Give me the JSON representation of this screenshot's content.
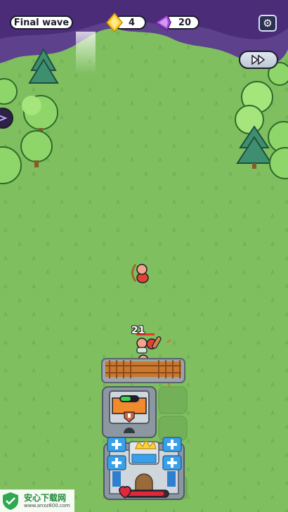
{
  "hud": {
    "wave_label": "Final wave",
    "gold_count": "4",
    "purple_count": "20"
  },
  "icons": {
    "settings": "gear-icon",
    "fast_forward": "fast-forward-icon",
    "gold_gem": "gold-diamond-icon",
    "purple_gem": "purple-crystal-icon",
    "heart": "heart-icon"
  },
  "battle": {
    "enemy_count": "21",
    "castle_health": 0.92
  },
  "colors": {
    "grass": "#7fbf5f",
    "fog": "#5c3a8e",
    "heart": "#e0283a",
    "gold": "#ffd23a",
    "purple": "#a34bd6"
  },
  "watermark": {
    "brand": "安心下载网",
    "site": "www.anxz800.com"
  }
}
